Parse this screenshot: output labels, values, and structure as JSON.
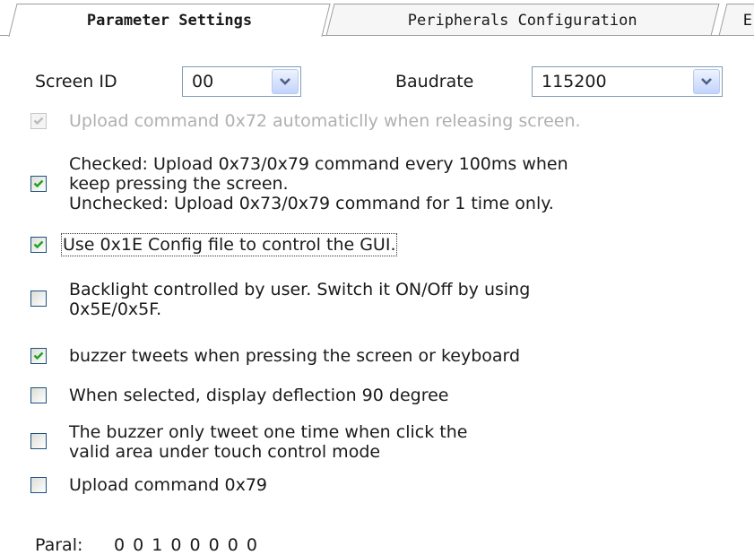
{
  "tabs": [
    {
      "label": "Parameter Settings"
    },
    {
      "label": "Peripherals Configuration"
    },
    {
      "label": "E"
    }
  ],
  "screen_id": {
    "label": "Screen ID",
    "value": "00"
  },
  "baudrate": {
    "label": "Baudrate",
    "value": "115200"
  },
  "options": [
    {
      "lines": [
        "Upload command 0x72 automaticlly when  releasing screen."
      ],
      "checked": true,
      "disabled": true
    },
    {
      "lines": [
        "Checked: Upload 0x73/0x79 command every 100ms when",
        "keep pressing the screen.",
        "Unchecked: Upload 0x73/0x79 command for 1 time only."
      ],
      "checked": true,
      "disabled": false
    },
    {
      "lines": [
        "Use 0x1E Config file to control the GUI."
      ],
      "checked": true,
      "disabled": false
    },
    {
      "lines": [
        "Backlight controlled by user. Switch it ON/Off by using",
        "0x5E/0x5F."
      ],
      "checked": false,
      "disabled": false
    },
    {
      "lines": [
        "buzzer tweets when pressing the screen or keyboard"
      ],
      "checked": true,
      "disabled": false
    },
    {
      "lines": [
        "When selected, display deflection 90 degree"
      ],
      "checked": false,
      "disabled": false
    },
    {
      "lines": [
        "The buzzer only tweet one time when click the",
        "valid area under touch control mode"
      ],
      "checked": false,
      "disabled": false
    },
    {
      "lines": [
        "Upload command 0x79"
      ],
      "checked": false,
      "disabled": false
    }
  ],
  "paral": {
    "label": "Paral:",
    "value": "0 0 1 0 0 0 0 0"
  },
  "colors": {
    "check": "#21a121",
    "check_disabled": "#bcbcbc",
    "disabled_text": "#b0b0b0"
  }
}
